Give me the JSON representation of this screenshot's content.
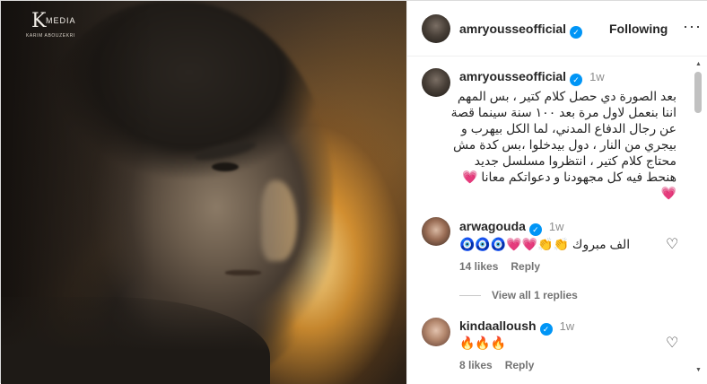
{
  "logo": {
    "mark": "K",
    "word": "MEDIA",
    "sub": "KARIM ABOUZEKRI"
  },
  "header": {
    "username": "amryousseofficial",
    "follow_label": "Following",
    "more_icon": "more-icon"
  },
  "post": {
    "username": "amryousseofficial",
    "time": "1w",
    "caption_lines": [
      "بعد الصورة دي حصل كلام كتير ، بس المهم",
      "اننا بنعمل لاول مرة بعد ١٠٠ سنة سينما قصة",
      "عن رجال الدفاع المدني، لما الكل بيهرب و",
      "بيجري من النار ، دول بيدخلوا ،بس كدة مش",
      "محتاج كلام كتير ، انتظروا مسلسل جديد",
      "هنحط فيه كل مجهودنا و دعواتكم معانا 💗",
      "💗"
    ]
  },
  "comments": [
    {
      "username": "arwagouda",
      "time": "1w",
      "text": "الف مبروك 👏👏💗💗🧿🧿🧿",
      "likes": "14 likes",
      "reply": "Reply"
    },
    {
      "username": "kindaalloush",
      "time": "1w",
      "text": "🔥🔥🔥",
      "likes": "8 likes",
      "reply": "Reply"
    }
  ],
  "view_replies": "View all 1 replies",
  "icons": {
    "verified": "verified-badge-icon",
    "like": "heart-outline-icon"
  },
  "colors": {
    "verified": "#0095f6",
    "meta": "#737373",
    "text": "#262626"
  }
}
